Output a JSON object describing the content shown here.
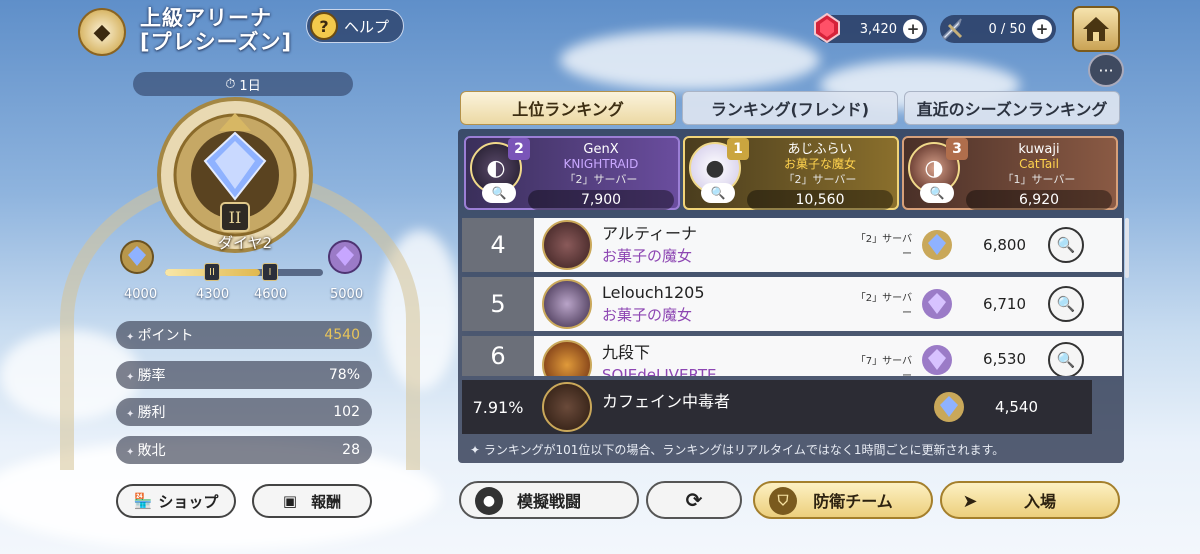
{
  "header": {
    "title_line1": "上級アリーナ",
    "title_line2": "[プレシーズン]",
    "help_label": "ヘルプ",
    "help_symbol": "?"
  },
  "currencies": {
    "gems": {
      "value": "3,420",
      "icon": "red-gem-icon"
    },
    "tickets": {
      "value": "0 / 50",
      "icon": "sword-ticket-icon"
    }
  },
  "timer": {
    "text": "1日"
  },
  "rank": {
    "tier_name": "ダイヤ2",
    "progress": 0.6,
    "thresholds": [
      "4000",
      "4300",
      "4600",
      "5000"
    ],
    "tick_labels": [
      "II",
      "I"
    ]
  },
  "stats": [
    {
      "label": "ポイント",
      "value": "4540",
      "highlight": "#e7c45a"
    },
    {
      "label": "勝率",
      "value": "78%",
      "highlight": "#ffffff"
    },
    {
      "label": "勝利",
      "value": "102",
      "highlight": "#ffffff"
    },
    {
      "label": "敗北",
      "value": "28",
      "highlight": "#ffffff"
    }
  ],
  "left_buttons": {
    "shop": "ショップ",
    "reward": "報酬"
  },
  "tabs": [
    {
      "label": "上位ランキング",
      "active": true
    },
    {
      "label": "ランキング(フレンド)",
      "active": false
    },
    {
      "label": "直近のシーズンランキング",
      "active": false
    }
  ],
  "top3": [
    {
      "rank": "2",
      "name": "GenX",
      "guild": "KNIGHTRAID",
      "server": "「2」サーバー",
      "score": "7,900",
      "color": "#7a55b8"
    },
    {
      "rank": "1",
      "name": "あじふらい",
      "guild": "お菓子な魔女",
      "server": "「2」サーバー",
      "score": "10,560",
      "color": "#caa53f"
    },
    {
      "rank": "3",
      "name": "kuwaji",
      "guild": "CatTail",
      "server": "「1」サーバー",
      "score": "6,920",
      "color": "#b06e4c"
    }
  ],
  "list": [
    {
      "rank": "4",
      "name": "アルティーナ",
      "guild": "お菓子の魔女",
      "server": "「2」サーバー",
      "score": "6,800"
    },
    {
      "rank": "5",
      "name": "Lelouch1205",
      "guild": "お菓子の魔女",
      "server": "「2」サーバー",
      "score": "6,710"
    },
    {
      "rank": "6",
      "name": "九段下",
      "guild": "SOIEdeLIVERTE",
      "server": "「7」サーバー",
      "score": "6,530"
    }
  ],
  "self": {
    "percent": "7.91%",
    "name": "カフェイン中毒者",
    "score": "4,540"
  },
  "note": "ランキングが101位以下の場合、ランキングはリアルタイムではなく1時間ごとに更新されます。",
  "bottom_buttons": {
    "mock_battle": "模擬戦闘",
    "defense_team": "防衛チーム",
    "enter": "入場"
  },
  "colors": {
    "accent_gold": "#e7c45a",
    "guild_purple": "#8d46b3",
    "guild_gold": "#ffd34e"
  }
}
